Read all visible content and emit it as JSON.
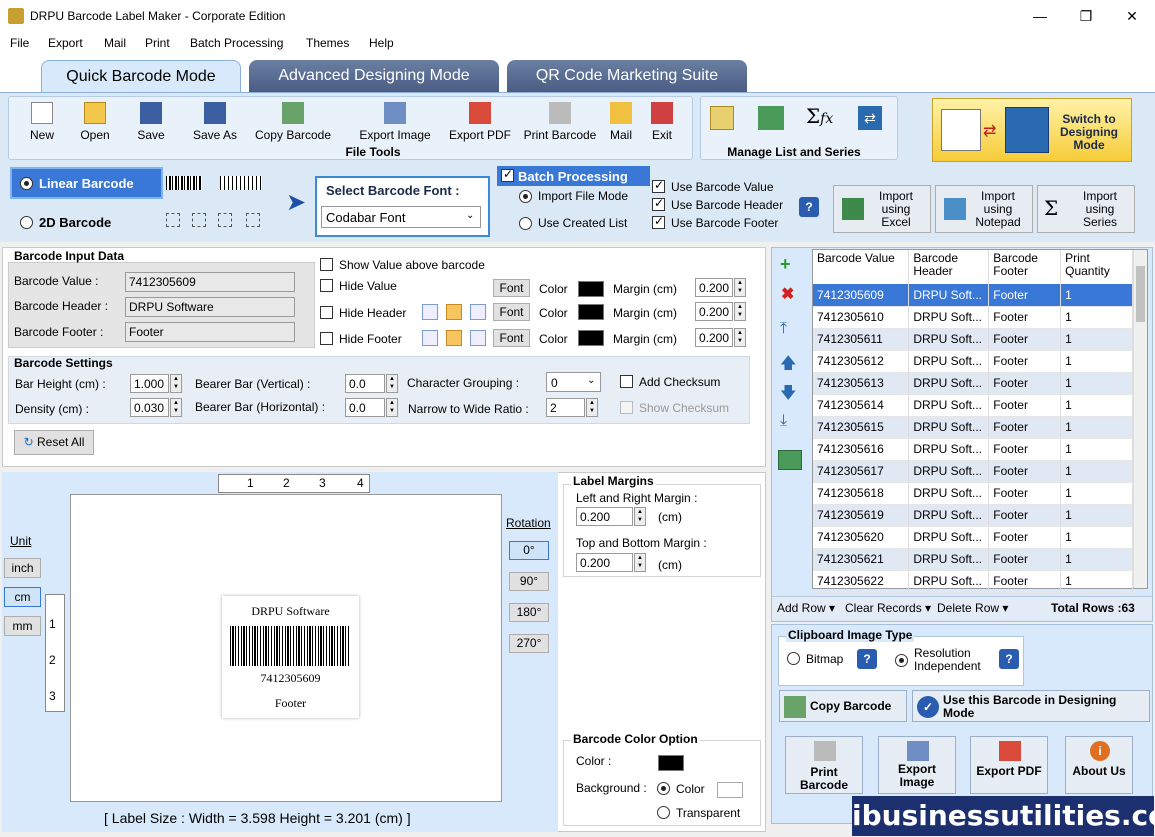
{
  "window": {
    "title": "DRPU Barcode Label Maker - Corporate Edition"
  },
  "menu": [
    "File",
    "Export",
    "Mail",
    "Print",
    "Batch Processing",
    "Themes",
    "Help"
  ],
  "tabs": [
    "Quick Barcode Mode",
    "Advanced Designing Mode",
    "QR Code Marketing Suite"
  ],
  "file_tools": {
    "label": "File Tools",
    "buttons": [
      "New",
      "Open",
      "Save",
      "Save As",
      "Copy Barcode",
      "Export Image",
      "Export PDF",
      "Print Barcode",
      "Mail",
      "Exit"
    ]
  },
  "manage": {
    "label": "Manage List and Series"
  },
  "switch_mode": {
    "label": "Switch to Designing Mode"
  },
  "barcode_type": {
    "linear": "Linear Barcode",
    "twod": "2D Barcode",
    "font_title": "Select Barcode Font :",
    "font_value": "Codabar Font"
  },
  "batch": {
    "title": "Batch Processing",
    "import_file": "Import File Mode",
    "use_created": "Use Created List",
    "use_value": "Use Barcode Value",
    "use_header": "Use Barcode Header",
    "use_footer": "Use Barcode Footer",
    "imports": [
      "Import using Excel",
      "Import using Notepad",
      "Import using Series"
    ]
  },
  "input": {
    "title": "Barcode Input Data",
    "value_label": "Barcode Value :",
    "value": "7412305609",
    "header_label": "Barcode Header :",
    "header": "DRPU Software",
    "footer_label": "Barcode Footer :",
    "footer": "Footer",
    "show_above": "Show Value above barcode",
    "hide_value": "Hide Value",
    "hide_header": "Hide Header",
    "hide_footer": "Hide Footer",
    "font": "Font",
    "color": "Color",
    "margin": "Margin (cm)",
    "margins": [
      "0.200",
      "0.200",
      "0.200"
    ]
  },
  "settings": {
    "title": "Barcode Settings",
    "bar_height_label": "Bar Height (cm) :",
    "bar_height": "1.000",
    "density_label": "Density (cm) :",
    "density": "0.030",
    "bearer_v_label": "Bearer Bar (Vertical) :",
    "bearer_v": "0.0",
    "bearer_h_label": "Bearer Bar (Horizontal) :",
    "bearer_h": "0.0",
    "grouping_label": "Character Grouping :",
    "grouping": "0",
    "ratio_label": "Narrow to Wide Ratio :",
    "ratio": "2",
    "add_checksum": "Add Checksum",
    "show_checksum": "Show Checksum",
    "reset": "Reset All"
  },
  "canvas": {
    "unit_label": "Unit",
    "units": [
      "inch",
      "cm",
      "mm"
    ],
    "ruler_h": [
      "1",
      "2",
      "3",
      "4"
    ],
    "ruler_v": [
      "1",
      "2",
      "3"
    ],
    "label_header": "DRPU Software",
    "label_value": "7412305609",
    "label_footer": "Footer",
    "rotation_label": "Rotation",
    "rotations": [
      "0°",
      "90°",
      "180°",
      "270°"
    ],
    "label_size": "[ Label Size : Width = 3.598   Height = 3.201 (cm) ]"
  },
  "label_margins": {
    "title": "Label Margins",
    "lr_label": "Left and Right Margin :",
    "lr": "0.200",
    "tb_label": "Top and Bottom Margin :",
    "tb": "0.200",
    "unit": "(cm)"
  },
  "color_option": {
    "title": "Barcode Color Option",
    "color_label": "Color :",
    "bg_label": "Background :",
    "color_opt": "Color",
    "transparent": "Transparent"
  },
  "grid": {
    "headers": [
      "Barcode Value",
      "Barcode Header",
      "Barcode Footer",
      "Print Quantity"
    ],
    "rows": [
      [
        "7412305609",
        "DRPU Soft...",
        "Footer",
        "1"
      ],
      [
        "7412305610",
        "DRPU Soft...",
        "Footer",
        "1"
      ],
      [
        "7412305611",
        "DRPU Soft...",
        "Footer",
        "1"
      ],
      [
        "7412305612",
        "DRPU Soft...",
        "Footer",
        "1"
      ],
      [
        "7412305613",
        "DRPU Soft...",
        "Footer",
        "1"
      ],
      [
        "7412305614",
        "DRPU Soft...",
        "Footer",
        "1"
      ],
      [
        "7412305615",
        "DRPU Soft...",
        "Footer",
        "1"
      ],
      [
        "7412305616",
        "DRPU Soft...",
        "Footer",
        "1"
      ],
      [
        "7412305617",
        "DRPU Soft...",
        "Footer",
        "1"
      ],
      [
        "7412305618",
        "DRPU Soft...",
        "Footer",
        "1"
      ],
      [
        "7412305619",
        "DRPU Soft...",
        "Footer",
        "1"
      ],
      [
        "7412305620",
        "DRPU Soft...",
        "Footer",
        "1"
      ],
      [
        "7412305621",
        "DRPU Soft...",
        "Footer",
        "1"
      ],
      [
        "7412305622",
        "DRPU Soft...",
        "Footer",
        "1"
      ]
    ],
    "add_row": "Add Row",
    "clear": "Clear Records",
    "delete": "Delete Row",
    "total": "Total Rows :63"
  },
  "clipboard": {
    "title": "Clipboard Image Type",
    "bitmap": "Bitmap",
    "resolution": "Resolution Independent"
  },
  "actions": {
    "copy": "Copy Barcode",
    "use": "Use this Barcode in Designing Mode",
    "print": "Print Barcode",
    "export_image": "Export Image",
    "export_pdf": "Export PDF",
    "about": "About Us"
  },
  "watermark": "ibusinessutilities.com"
}
